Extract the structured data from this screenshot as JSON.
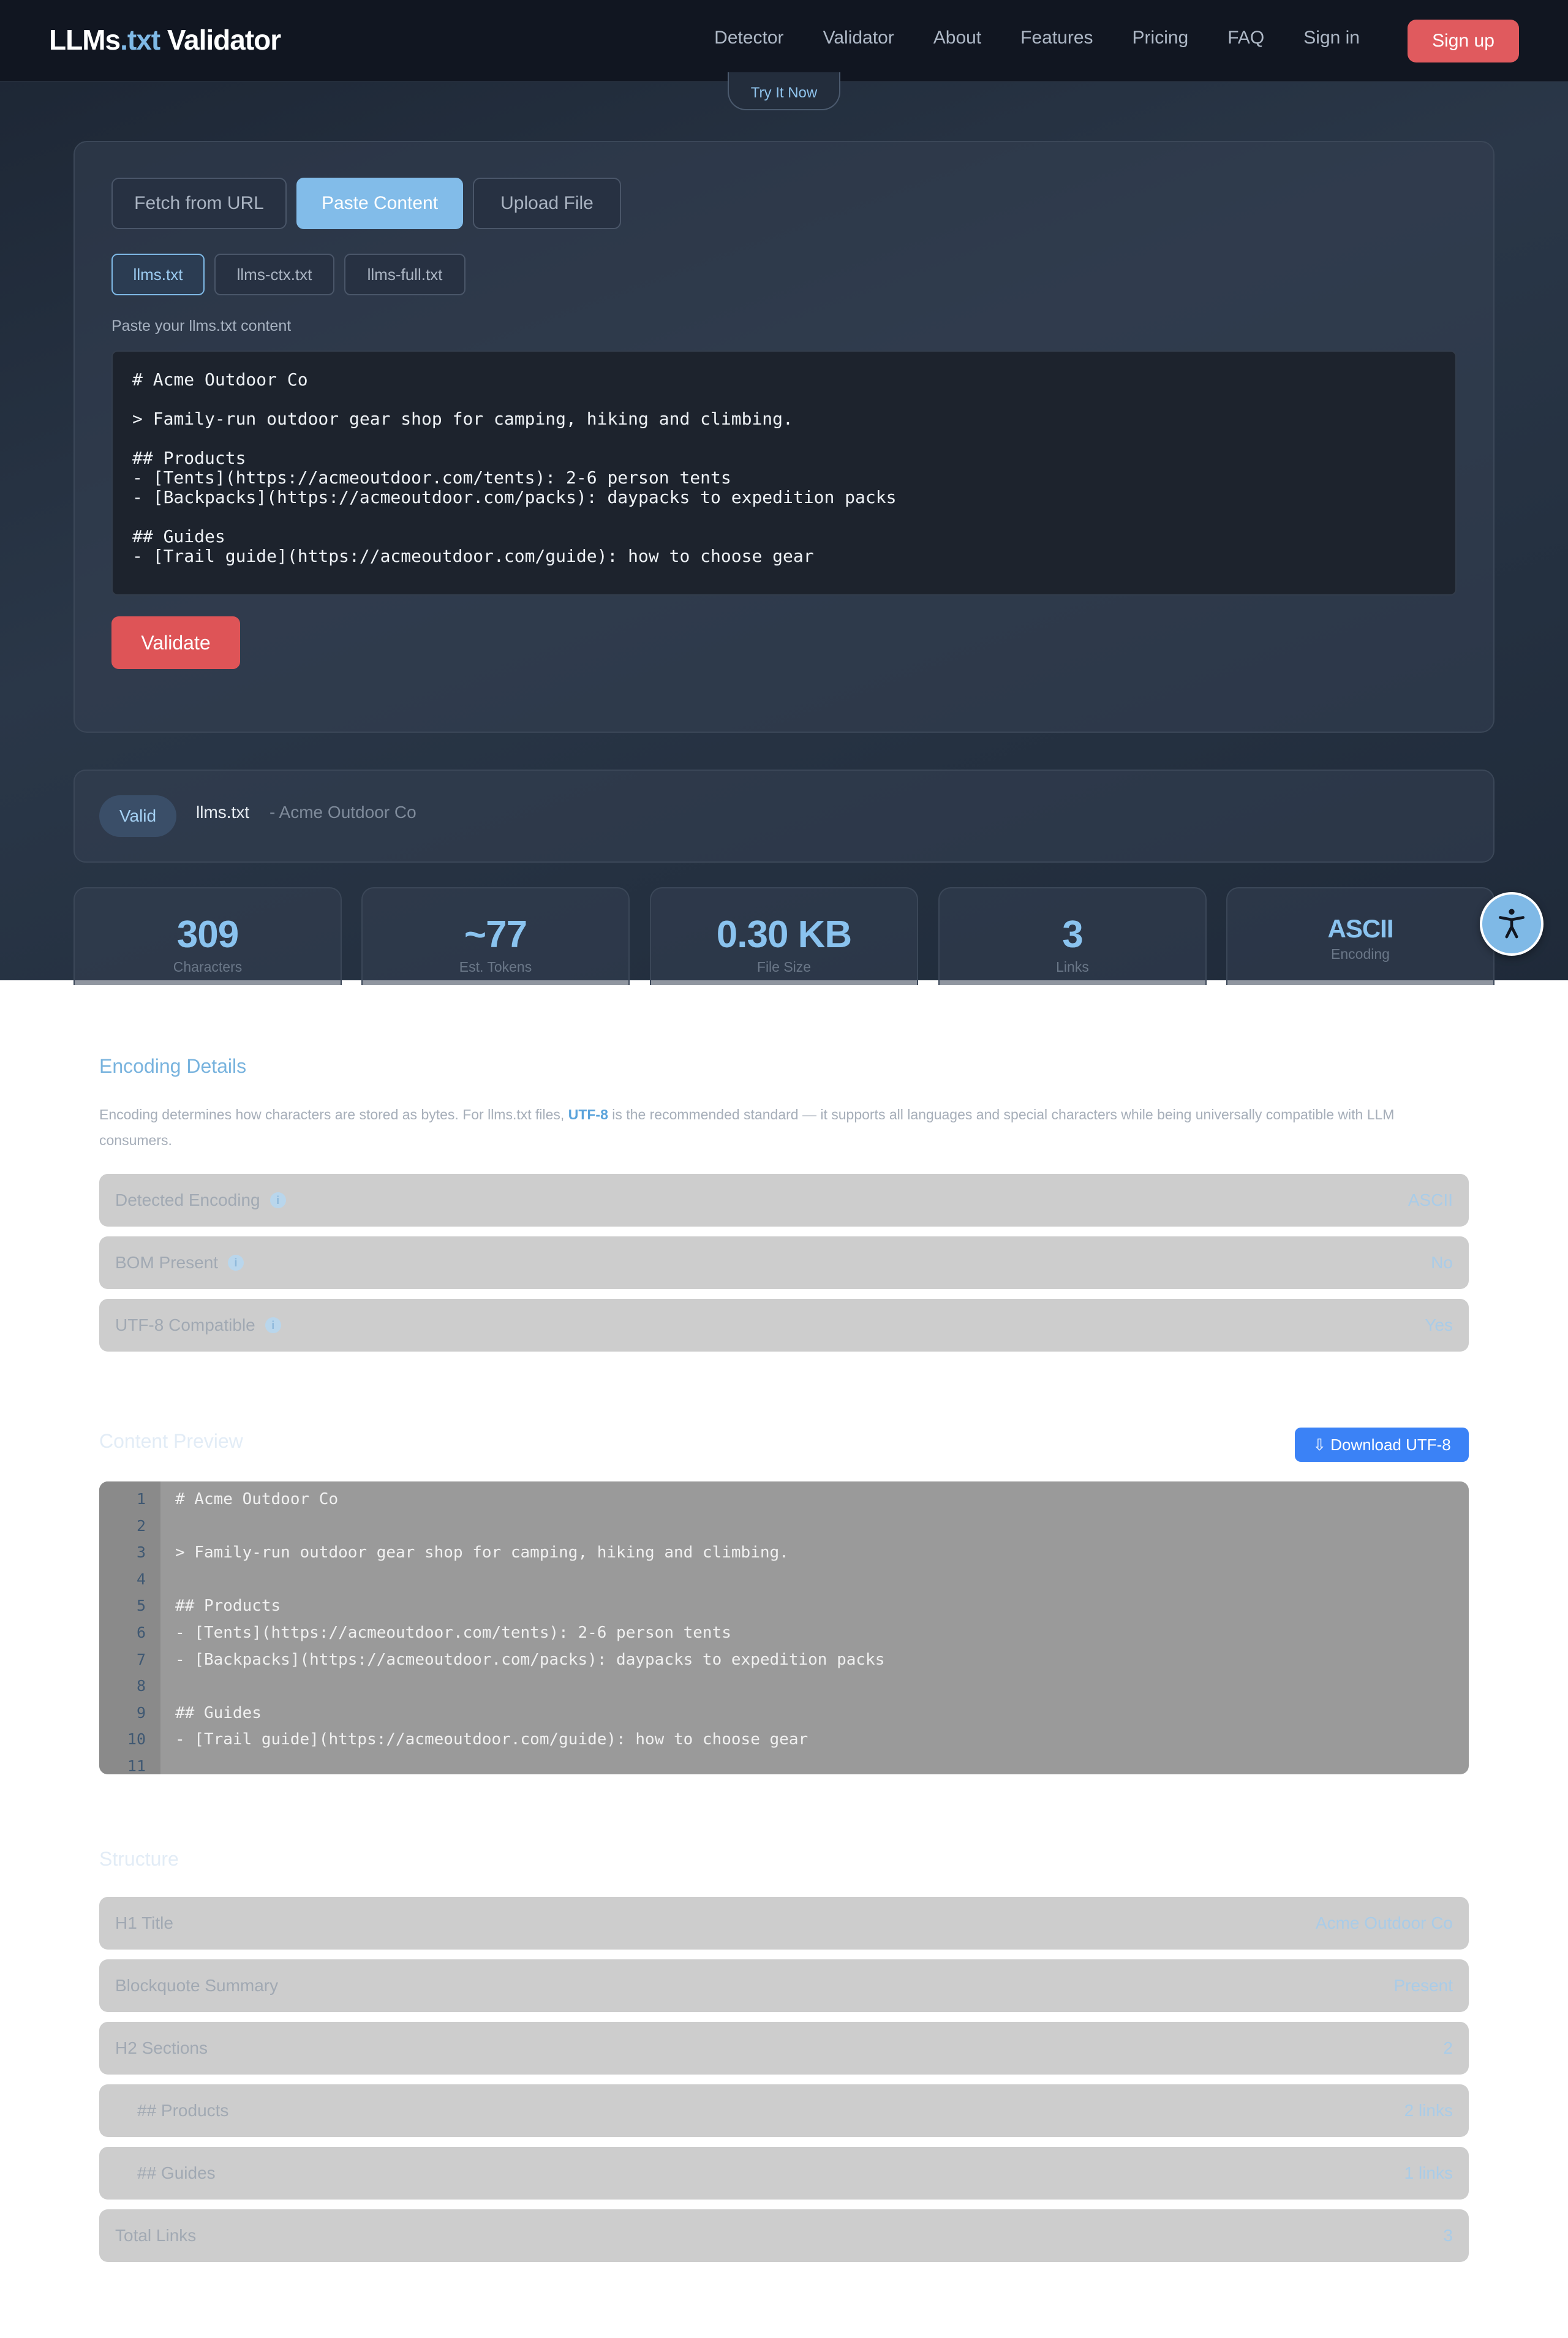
{
  "brand": {
    "prefix": "LLMs",
    "accent": ".txt",
    "suffix": " Validator"
  },
  "nav": {
    "links": [
      "Detector",
      "Validator",
      "About",
      "Features",
      "Pricing",
      "FAQ",
      "Sign in"
    ],
    "signup": "Sign up"
  },
  "hero": {
    "try_label": "Try It Now"
  },
  "input": {
    "tabs": [
      "Fetch from URL",
      "Paste Content",
      "Upload File"
    ],
    "active_tab": "Paste Content",
    "file_tabs": [
      "llms.txt",
      "llms-ctx.txt",
      "llms-full.txt"
    ],
    "active_file_tab": "llms.txt",
    "paste_label": "Paste your llms.txt content",
    "content": "# Acme Outdoor Co\n\n> Family-run outdoor gear shop for camping, hiking and climbing.\n\n## Products\n- [Tents](https://acmeoutdoor.com/tents): 2-6 person tents\n- [Backpacks](https://acmeoutdoor.com/packs): daypacks to expedition packs\n\n## Guides\n- [Trail guide](https://acmeoutdoor.com/guide): how to choose gear",
    "validate_label": "Validate"
  },
  "result": {
    "badge": "Valid",
    "file": "llms.txt",
    "name": "- Acme Outdoor Co"
  },
  "stats": [
    {
      "value": "309",
      "label": "Characters"
    },
    {
      "value": "~77",
      "label": "Est. Tokens"
    },
    {
      "value": "0.30 KB",
      "label": "File Size"
    },
    {
      "value": "3",
      "label": "Links"
    },
    {
      "value": "ASCII",
      "label": "Encoding"
    }
  ],
  "encoding": {
    "title": "Encoding Details",
    "desc_before": "Encoding determines how characters are stored as bytes. For llms.txt files, ",
    "desc_highlight": "UTF-8",
    "desc_after": " is the recommended standard — it supports all languages and special characters while being universally compatible with LLM consumers.",
    "rows": [
      {
        "label": "Detected Encoding",
        "value": "ASCII"
      },
      {
        "label": "BOM Present",
        "value": "No"
      },
      {
        "label": "UTF-8 Compatible",
        "value": "Yes"
      }
    ],
    "info_glyph": "i"
  },
  "preview": {
    "title": "Content Preview",
    "download_label": "⇩ Download UTF-8",
    "lines": [
      "# Acme Outdoor Co",
      "",
      "> Family-run outdoor gear shop for camping, hiking and climbing.",
      "",
      "## Products",
      "- [Tents](https://acmeoutdoor.com/tents): 2-6 person tents",
      "- [Backpacks](https://acmeoutdoor.com/packs): daypacks to expedition packs",
      "",
      "## Guides",
      "- [Trail guide](https://acmeoutdoor.com/guide): how to choose gear",
      ""
    ]
  },
  "structure": {
    "title": "Structure",
    "rows": [
      {
        "label": "H1 Title",
        "value": "Acme Outdoor Co",
        "indent": false
      },
      {
        "label": "Blockquote Summary",
        "value": "Present",
        "indent": false
      },
      {
        "label": "H2 Sections",
        "value": "2",
        "indent": false
      },
      {
        "label": "## Products",
        "value": "2 links",
        "indent": true
      },
      {
        "label": "## Guides",
        "value": "1 links",
        "indent": true
      },
      {
        "label": "Total Links",
        "value": "3",
        "indent": false
      }
    ]
  },
  "icons": {
    "accessibility": "accessibility-icon",
    "info": "info-icon"
  },
  "colors": {
    "accent": "#7fb9e6",
    "signup": "#e05a5e",
    "validate": "#de5457",
    "download": "#3b82f6"
  }
}
